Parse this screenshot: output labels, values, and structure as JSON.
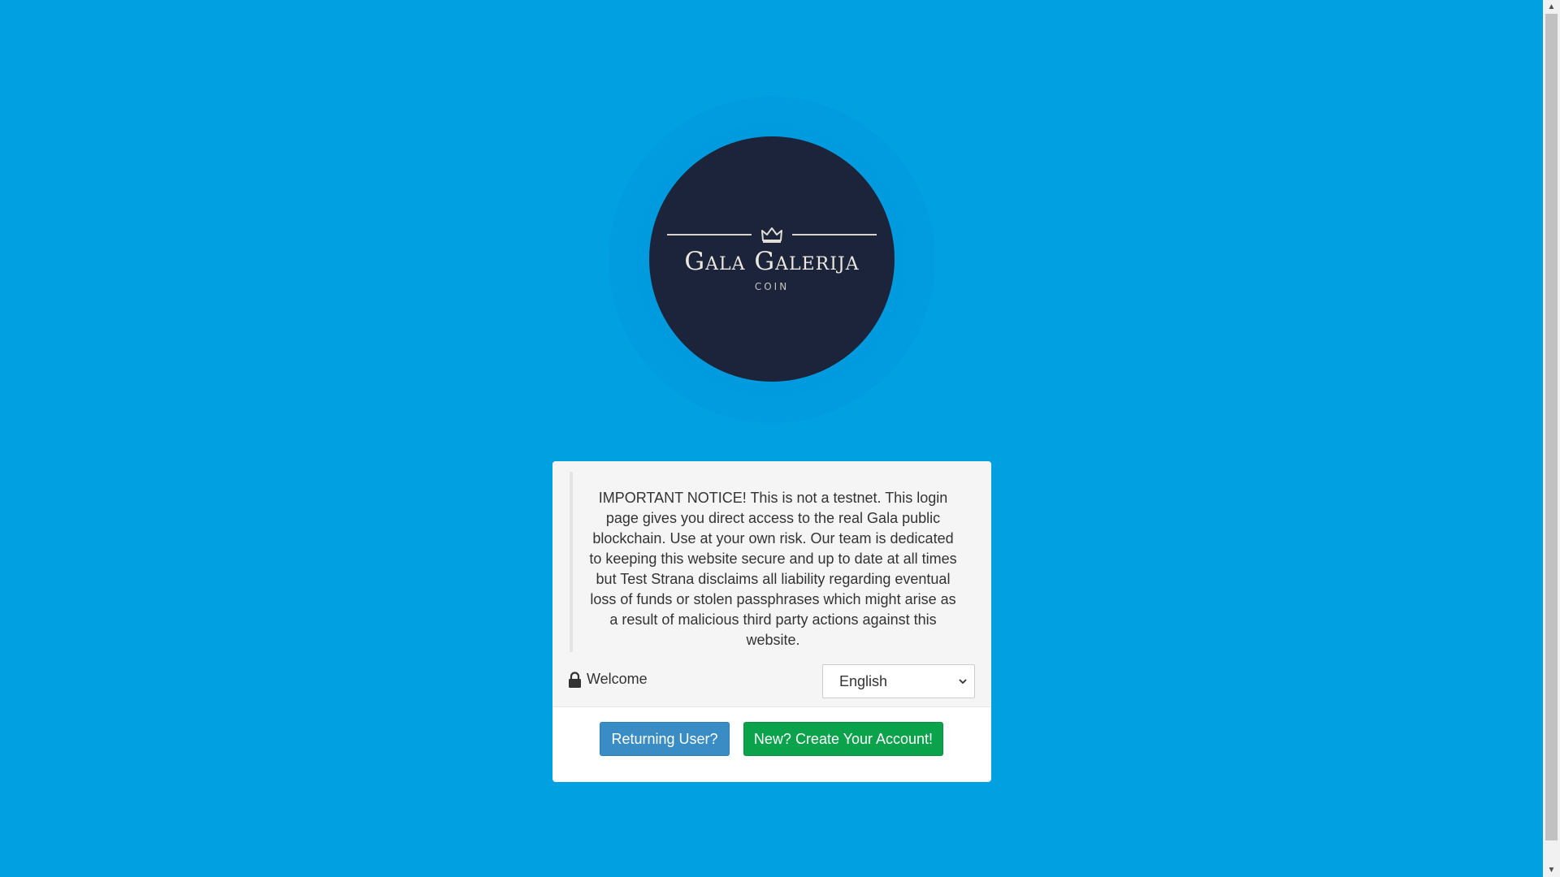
{
  "logo": {
    "title": "Gala Galerija",
    "subtitle": "COIN",
    "icon": "crown-icon"
  },
  "card": {
    "notice": "IMPORTANT NOTICE! This is not a testnet. This login page gives you direct access to the real Gala public blockchain. Use at your own risk. Our team is dedicated to keeping this website secure and up to date at all times but Test Strana disclaims all liability regarding eventual loss of funds or stolen passphrases which might arise as a result of malicious third party actions against this website.",
    "welcome_label": "Welcome",
    "welcome_icon": "lock-icon",
    "language": {
      "selected": "English",
      "icon": "chevron-down-icon"
    },
    "buttons": {
      "returning": "Returning User?",
      "create": "New? Create Your Account!"
    }
  },
  "colors": {
    "background": "#00a0e1",
    "logo_circle": "#1b243a",
    "returning_button": "#3a8dc4",
    "create_button": "#0aa24b"
  }
}
